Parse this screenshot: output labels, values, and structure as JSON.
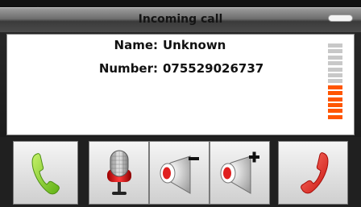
{
  "title": "Incoming call",
  "caller": {
    "name_label": "Name:",
    "name_value": "Unknown",
    "number_label": "Number:",
    "number_value": "075529026737"
  },
  "volume": {
    "total_segments": 13,
    "active_segments": 6,
    "active_color": "#ff5500",
    "inactive_color": "#c8c8c8"
  },
  "colors": {
    "answer": "#7ed321",
    "reject": "#e8231c"
  },
  "icons": {
    "answer": "phone-answer-icon",
    "mic": "microphone-icon",
    "volume_down": "speaker-minus-icon",
    "volume_up": "speaker-plus-icon",
    "reject": "phone-reject-icon"
  }
}
